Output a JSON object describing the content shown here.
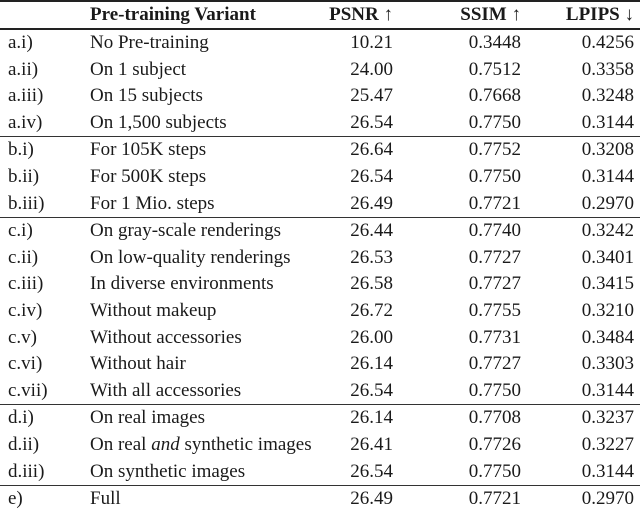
{
  "table": {
    "headers": {
      "id": "",
      "variant": "Pre-training Variant",
      "psnr": "PSNR ↑",
      "ssim": "SSIM ↑",
      "lpips": "LPIPS ↓"
    },
    "groups": [
      {
        "name": "a",
        "rows": [
          {
            "id": "a.i)",
            "variant": "No Pre-training",
            "psnr": "10.21",
            "ssim": "0.3448",
            "lpips": "0.4256"
          },
          {
            "id": "a.ii)",
            "variant": "On 1 subject",
            "psnr": "24.00",
            "ssim": "0.7512",
            "lpips": "0.3358"
          },
          {
            "id": "a.iii)",
            "variant": "On 15 subjects",
            "psnr": "25.47",
            "ssim": "0.7668",
            "lpips": "0.3248"
          },
          {
            "id": "a.iv)",
            "variant": "On 1,500 subjects",
            "psnr": "26.54",
            "ssim": "0.7750",
            "lpips": "0.3144"
          }
        ]
      },
      {
        "name": "b",
        "rows": [
          {
            "id": "b.i)",
            "variant": "For 105K steps",
            "psnr": "26.64",
            "ssim": "0.7752",
            "lpips": "0.3208"
          },
          {
            "id": "b.ii)",
            "variant": "For 500K steps",
            "psnr": "26.54",
            "ssim": "0.7750",
            "lpips": "0.3144"
          },
          {
            "id": "b.iii)",
            "variant": "For 1 Mio. steps",
            "psnr": "26.49",
            "ssim": "0.7721",
            "lpips": "0.2970"
          }
        ]
      },
      {
        "name": "c",
        "rows": [
          {
            "id": "c.i)",
            "variant": "On gray-scale renderings",
            "psnr": "26.44",
            "ssim": "0.7740",
            "lpips": "0.3242"
          },
          {
            "id": "c.ii)",
            "variant": "On low-quality renderings",
            "psnr": "26.53",
            "ssim": "0.7727",
            "lpips": "0.3401"
          },
          {
            "id": "c.iii)",
            "variant": "In diverse environments",
            "psnr": "26.58",
            "ssim": "0.7727",
            "lpips": "0.3415"
          },
          {
            "id": "c.iv)",
            "variant": "Without makeup",
            "psnr": "26.72",
            "ssim": "0.7755",
            "lpips": "0.3210"
          },
          {
            "id": "c.v)",
            "variant": "Without accessories",
            "psnr": "26.00",
            "ssim": "0.7731",
            "lpips": "0.3484"
          },
          {
            "id": "c.vi)",
            "variant": "Without hair",
            "psnr": "26.14",
            "ssim": "0.7727",
            "lpips": "0.3303"
          },
          {
            "id": "c.vii)",
            "variant": "With all accessories",
            "psnr": "26.54",
            "ssim": "0.7750",
            "lpips": "0.3144"
          }
        ]
      },
      {
        "name": "d",
        "rows": [
          {
            "id": "d.i)",
            "variant": "On real images",
            "psnr": "26.14",
            "ssim": "0.7708",
            "lpips": "0.3237"
          },
          {
            "id": "d.ii)",
            "variant_parts": [
              "On real ",
              "and",
              " synthetic images"
            ],
            "variant": "On real and synthetic images",
            "psnr": "26.41",
            "ssim": "0.7726",
            "lpips": "0.3227"
          },
          {
            "id": "d.iii)",
            "variant": "On synthetic images",
            "psnr": "26.54",
            "ssim": "0.7750",
            "lpips": "0.3144"
          }
        ]
      },
      {
        "name": "e",
        "rows": [
          {
            "id": "e)",
            "variant": "Full",
            "psnr": "26.49",
            "ssim": "0.7721",
            "lpips": "0.2970"
          }
        ]
      }
    ]
  }
}
